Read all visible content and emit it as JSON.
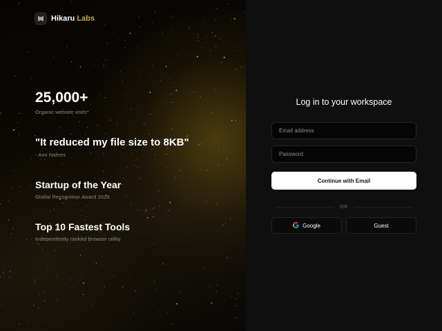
{
  "brand": {
    "name_first": "Hikaru",
    "name_second": "Labs",
    "accent": "#c9a84a",
    "logo_icon": "bolt-logo-icon"
  },
  "stats": [
    {
      "headline": "25,000+",
      "caption": "Organic website visits*"
    },
    {
      "headline": "\"It reduced my file size to 8KB\"",
      "caption": "- Ami Nafees"
    },
    {
      "headline": "Startup of the Year",
      "caption": "Global Recognition Award 2026"
    },
    {
      "headline": "Top 10 Fastest Tools",
      "caption": "Independently ranked browser utility"
    }
  ],
  "login": {
    "heading": "Log in to your workspace",
    "email_placeholder": "Email address",
    "email_value": "",
    "password_placeholder": "Password",
    "password_value": "",
    "continue_label": "Continue with Email",
    "divider_label": "OR",
    "google_label": "Google",
    "guest_label": "Guest"
  }
}
